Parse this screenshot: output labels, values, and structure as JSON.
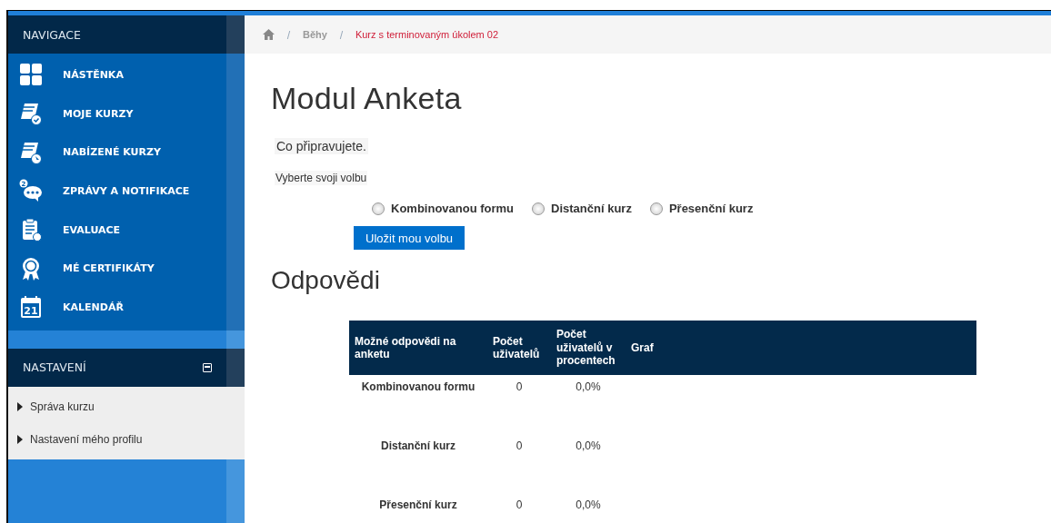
{
  "sidebar": {
    "navigation": {
      "title": "NAVIGACE",
      "items": [
        {
          "label": "NÁSTĚNKA",
          "kind": "dashboard"
        },
        {
          "label": "MOJE KURZY",
          "kind": "courses"
        },
        {
          "label": "NABÍZENÉ KURZY",
          "kind": "offered"
        },
        {
          "label": "ZPRÁVY A NOTIFIKACE",
          "kind": "messages",
          "badge": "2"
        },
        {
          "label": "EVALUACE",
          "kind": "evaluation"
        },
        {
          "label": "MÉ CERTIFIKÁTY",
          "kind": "certificates"
        },
        {
          "label": "KALENDÁŘ",
          "kind": "calendar",
          "badge": "21"
        }
      ]
    },
    "settings": {
      "title": "NASTAVENÍ",
      "expanded": true,
      "items": [
        {
          "label": "Správa kurzu",
          "expanded": false
        },
        {
          "label": "Nastavení mého profilu",
          "expanded": false
        }
      ]
    }
  },
  "breadcrumb": [
    {
      "label": "Běhy",
      "current": false
    },
    {
      "label": "Kurz s terminovaným úkolem 02",
      "current": true
    }
  ],
  "poll": {
    "title": "Modul Anketa",
    "question": "Co připravujete.",
    "prompt": "Vyberte svoji volbu",
    "options": [
      {
        "label": "Kombinovanou formu",
        "selected": false
      },
      {
        "label": "Distanční kurz",
        "selected": false
      },
      {
        "label": "Přesenční kurz",
        "selected": false
      }
    ],
    "button": "Uložit mou volbu"
  },
  "results": {
    "title": "Odpovědi",
    "columns": [
      "Možné odpovědi na anketu",
      "Počet uživatelů",
      "Počet uživatelů v procentech",
      "Graf"
    ],
    "rows": [
      [
        "Kombinovanou formu",
        "0",
        "0,0%"
      ],
      [
        "Distanční kurz",
        "0",
        "0,0%"
      ],
      [
        "Přesenční kurz",
        "0",
        "0,0%"
      ]
    ]
  }
}
